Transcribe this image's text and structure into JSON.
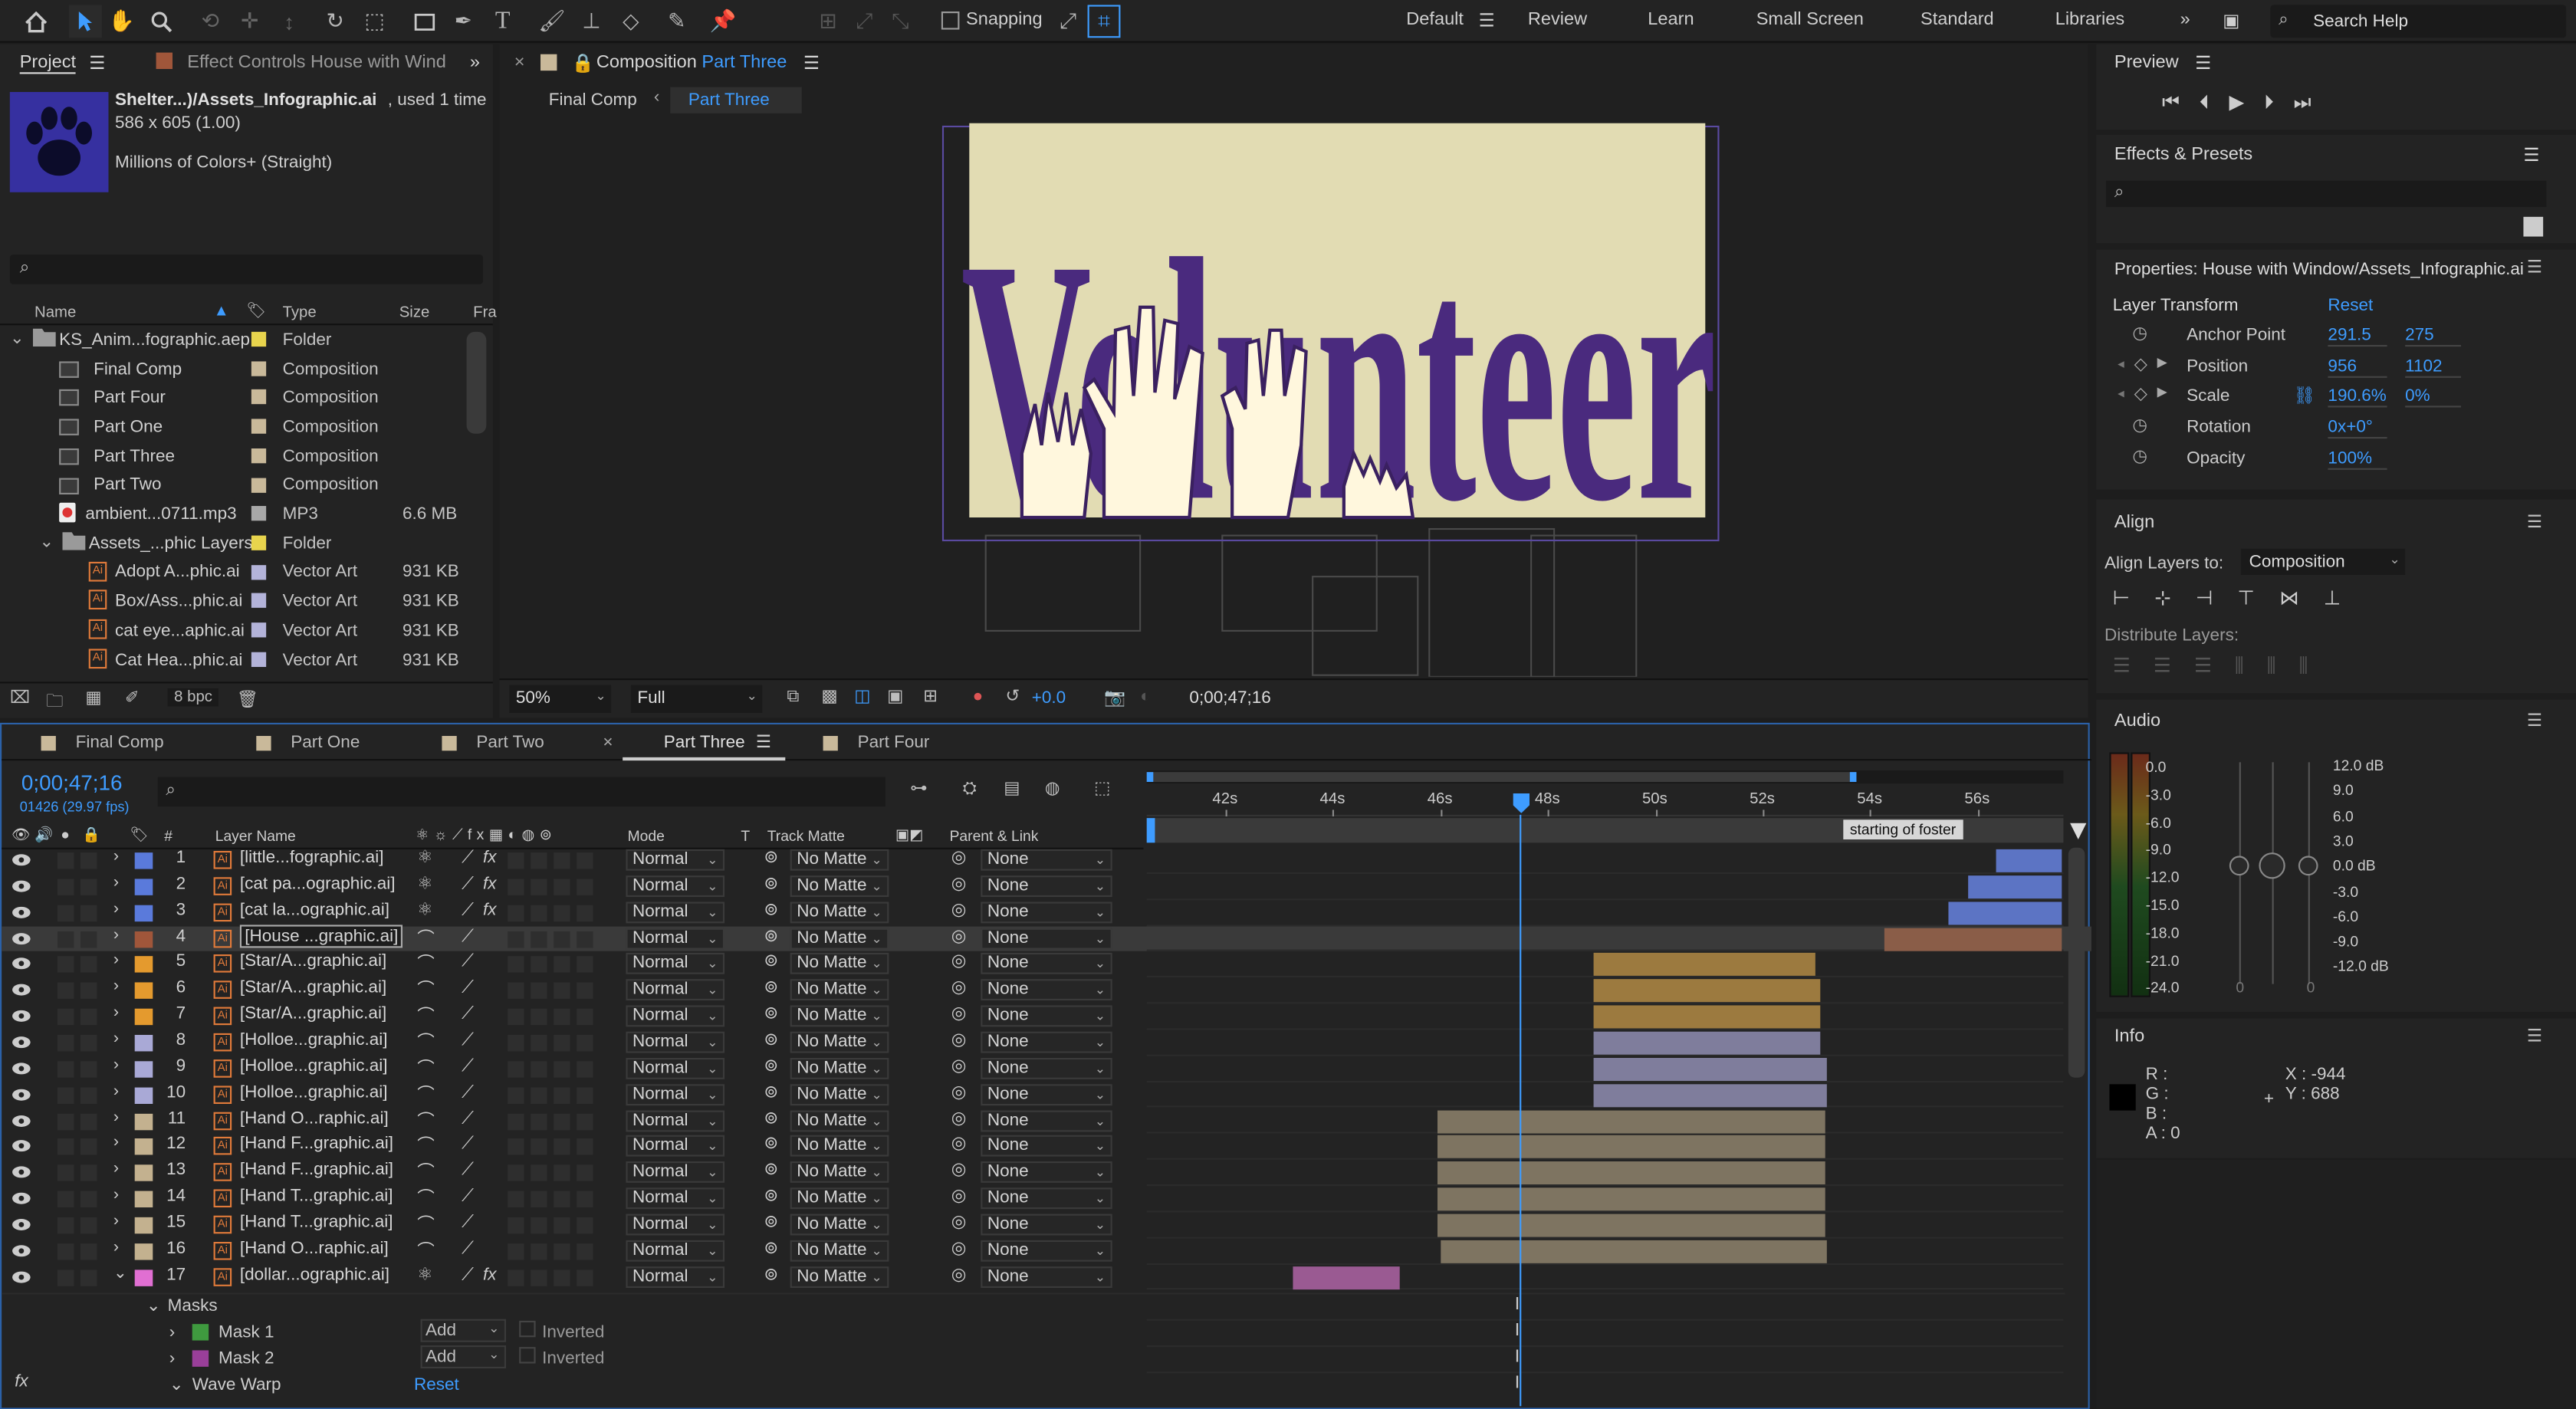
{
  "toolbar": {
    "snapping": "Snapping",
    "workspaces": [
      "Default",
      "Review",
      "Learn",
      "Small Screen",
      "Standard",
      "Libraries"
    ],
    "search_placeholder": "Search Help"
  },
  "project": {
    "tab": "Project",
    "effect_tab": "Effect Controls House with Wind",
    "asset": {
      "name": "Shelter...)/Assets_Infographic.ai",
      "used": ", used 1 time",
      "dims": "586 x 605 (1.00)",
      "colors": "Millions of Colors+ (Straight)"
    },
    "cols": {
      "name": "Name",
      "type": "Type",
      "size": "Size",
      "fr": "Fra"
    },
    "items": [
      {
        "name": "KS_Anim...fographic.aep",
        "type": "Folder",
        "size": "",
        "color": "#e8d44d",
        "kind": "folder"
      },
      {
        "name": "Final Comp",
        "type": "Composition",
        "size": "",
        "color": "#c9b99a",
        "kind": "comp"
      },
      {
        "name": "Part Four",
        "type": "Composition",
        "size": "",
        "color": "#c9b99a",
        "kind": "comp"
      },
      {
        "name": "Part One",
        "type": "Composition",
        "size": "",
        "color": "#c9b99a",
        "kind": "comp"
      },
      {
        "name": "Part Three",
        "type": "Composition",
        "size": "",
        "color": "#c9b99a",
        "kind": "comp"
      },
      {
        "name": "Part Two",
        "type": "Composition",
        "size": "",
        "color": "#c9b99a",
        "kind": "comp"
      },
      {
        "name": "ambient...0711.mp3",
        "type": "MP3",
        "size": "6.6 MB",
        "color": "#a8a8a8",
        "kind": "audio"
      },
      {
        "name": "Assets_...phic Layers",
        "type": "Folder",
        "size": "",
        "color": "#e8d44d",
        "kind": "folder"
      },
      {
        "name": "Adopt A...phic.ai",
        "type": "Vector Art",
        "size": "931 KB",
        "color": "#b3b3d9",
        "kind": "ai"
      },
      {
        "name": "Box/Ass...phic.ai",
        "type": "Vector Art",
        "size": "931 KB",
        "color": "#b3b3d9",
        "kind": "ai"
      },
      {
        "name": "cat eye...aphic.ai",
        "type": "Vector Art",
        "size": "931 KB",
        "color": "#b3b3d9",
        "kind": "ai"
      },
      {
        "name": "Cat Hea...phic.ai",
        "type": "Vector Art",
        "size": "931 KB",
        "color": "#b3b3d9",
        "kind": "ai"
      }
    ],
    "bpc": "8 bpc"
  },
  "comp": {
    "tab_prefix": "Composition",
    "tab_name": "Part Three",
    "crumbs": [
      "Final Comp",
      "Part Three"
    ],
    "word": "Volunteer",
    "zoom": "50%",
    "res": "Full",
    "exposure": "+0.0",
    "time": "0;00;47;16"
  },
  "timeline": {
    "tabs": [
      "Final Comp",
      "Part One",
      "Part Two",
      "Part Three",
      "Part Four"
    ],
    "timecode": "0;00;47;16",
    "frames": "01426 (29.97 fps)",
    "cols": {
      "hash": "#",
      "layer": "Layer Name",
      "mode": "Mode",
      "t": "T",
      "tm": "Track Matte",
      "parent": "Parent & Link"
    },
    "ruler": [
      "42s",
      "44s",
      "46s",
      "48s",
      "50s",
      "52s",
      "54s",
      "56s"
    ],
    "marker": "starting of foster",
    "layers": [
      {
        "n": "1",
        "name": "[little...fographic.ai]",
        "color": "#5a7adb",
        "fx": true,
        "mode": "Normal",
        "tm": "No Matte",
        "parent": "None"
      },
      {
        "n": "2",
        "name": "[cat pa...ographic.ai]",
        "color": "#5a7adb",
        "fx": true,
        "mode": "Normal",
        "tm": "No Matte",
        "parent": "None"
      },
      {
        "n": "3",
        "name": "[cat la...ographic.ai]",
        "color": "#5a7adb",
        "fx": true,
        "mode": "Normal",
        "tm": "No Matte",
        "parent": "None"
      },
      {
        "n": "4",
        "name": "[House ...graphic.ai]",
        "color": "#a0563a",
        "fx": false,
        "mode": "Normal",
        "tm": "No Matte",
        "parent": "None"
      },
      {
        "n": "5",
        "name": "[Star/A...graphic.ai]",
        "color": "#e49a2e",
        "fx": false,
        "mode": "Normal",
        "tm": "No Matte",
        "parent": "None"
      },
      {
        "n": "6",
        "name": "[Star/A...graphic.ai]",
        "color": "#e49a2e",
        "fx": false,
        "mode": "Normal",
        "tm": "No Matte",
        "parent": "None"
      },
      {
        "n": "7",
        "name": "[Star/A...graphic.ai]",
        "color": "#e49a2e",
        "fx": false,
        "mode": "Normal",
        "tm": "No Matte",
        "parent": "None"
      },
      {
        "n": "8",
        "name": "[Holloe...graphic.ai]",
        "color": "#a9a9d6",
        "fx": false,
        "mode": "Normal",
        "tm": "No Matte",
        "parent": "None"
      },
      {
        "n": "9",
        "name": "[Holloe...graphic.ai]",
        "color": "#a9a9d6",
        "fx": false,
        "mode": "Normal",
        "tm": "No Matte",
        "parent": "None"
      },
      {
        "n": "10",
        "name": "[Holloe...graphic.ai]",
        "color": "#a9a9d6",
        "fx": false,
        "mode": "Normal",
        "tm": "No Matte",
        "parent": "None"
      },
      {
        "n": "11",
        "name": "[Hand O...raphic.ai]",
        "color": "#c3b18f",
        "fx": false,
        "mode": "Normal",
        "tm": "No Matte",
        "parent": "None"
      },
      {
        "n": "12",
        "name": "[Hand F...graphic.ai]",
        "color": "#c3b18f",
        "fx": false,
        "mode": "Normal",
        "tm": "No Matte",
        "parent": "None"
      },
      {
        "n": "13",
        "name": "[Hand F...graphic.ai]",
        "color": "#c3b18f",
        "fx": false,
        "mode": "Normal",
        "tm": "No Matte",
        "parent": "None"
      },
      {
        "n": "14",
        "name": "[Hand T...graphic.ai]",
        "color": "#c3b18f",
        "fx": false,
        "mode": "Normal",
        "tm": "No Matte",
        "parent": "None"
      },
      {
        "n": "15",
        "name": "[Hand T...graphic.ai]",
        "color": "#c3b18f",
        "fx": false,
        "mode": "Normal",
        "tm": "No Matte",
        "parent": "None"
      },
      {
        "n": "16",
        "name": "[Hand O...raphic.ai]",
        "color": "#c3b18f",
        "fx": false,
        "mode": "Normal",
        "tm": "No Matte",
        "parent": "None"
      },
      {
        "n": "17",
        "name": "[dollar...ographic.ai]",
        "color": "#e06fd2",
        "fx": true,
        "mode": "Normal",
        "tm": "No Matte",
        "parent": "None"
      }
    ],
    "sub": {
      "masks": "Masks",
      "mask1": "Mask 1",
      "mask2": "Mask 2",
      "add": "Add",
      "inverted": "Inverted",
      "wave": "Wave Warp",
      "reset": "Reset"
    }
  },
  "preview": {
    "title": "Preview"
  },
  "effects": {
    "title": "Effects & Presets"
  },
  "props": {
    "title": "Properties: House with Window/Assets_Infographic.ai",
    "section": "Layer Transform",
    "reset": "Reset",
    "rows": [
      {
        "label": "Anchor Point",
        "v1": "291.5",
        "v2": "275"
      },
      {
        "label": "Position",
        "v1": "956",
        "v2": "1102"
      },
      {
        "label": "Scale",
        "v1": "190.6%",
        "v2": "0%"
      },
      {
        "label": "Rotation",
        "v1": "0x+0°",
        "v2": ""
      },
      {
        "label": "Opacity",
        "v1": "100%",
        "v2": ""
      }
    ]
  },
  "align": {
    "title": "Align",
    "to_label": "Align Layers to:",
    "to_value": "Composition",
    "distribute": "Distribute Layers:"
  },
  "audio": {
    "title": "Audio",
    "left": [
      "0.0",
      "-3.0",
      "-6.0",
      "-9.0",
      "-12.0",
      "-15.0",
      "-18.0",
      "-21.0",
      "-24.0"
    ],
    "right": [
      "12.0 dB",
      "9.0",
      "6.0",
      "3.0",
      "0.0 dB",
      "-3.0",
      "-6.0",
      "-9.0",
      "-12.0 dB"
    ],
    "zero": "0"
  },
  "info": {
    "title": "Info",
    "r": "R :",
    "g": "G :",
    "b": "B :",
    "a": "A :  0",
    "x": "X : -944",
    "y": "Y :  688"
  },
  "colors": {
    "accent": "#3e9cff",
    "purple": "#4a2a7e",
    "cream": "#e2dcb3"
  }
}
